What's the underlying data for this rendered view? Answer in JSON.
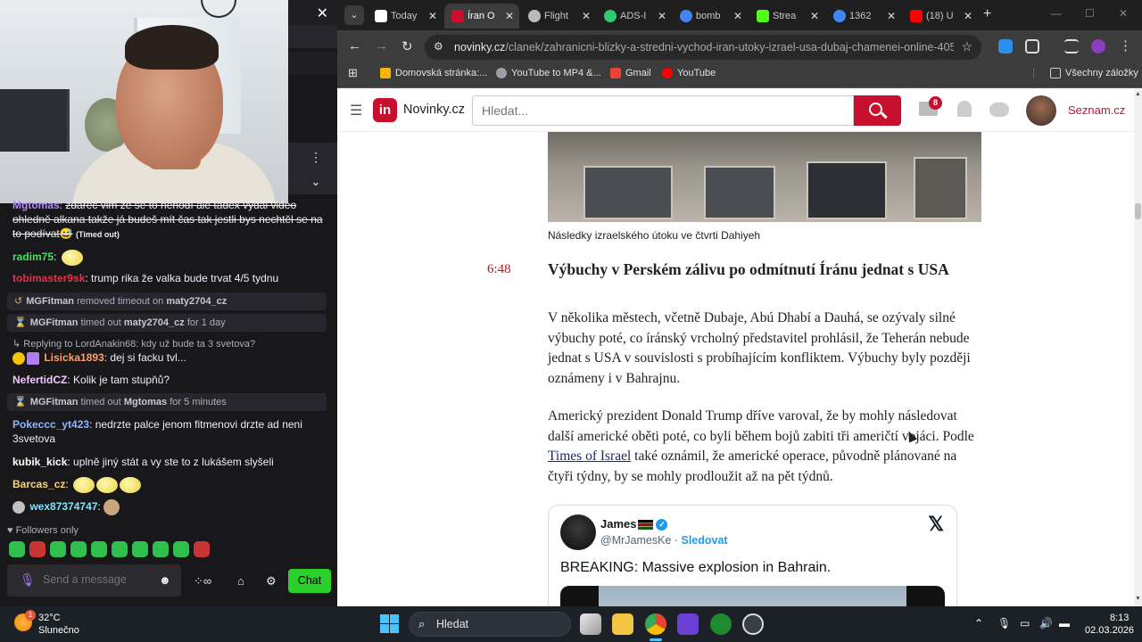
{
  "chat": {
    "close_glyph": "✕",
    "menu_glyph": "⋮",
    "collapse_glyph": "⌄",
    "messages": [
      {
        "user": "Mgtomas",
        "user_color": "#b488ff",
        "text": "zdarec vim že se to nehodí ale tadex vydal video ohledně alkana takže já budeš mít čas tak jestli bys nechtěl se na to podívat😅",
        "timed_out_label": "(Timed out)"
      },
      {
        "user": "radim75",
        "user_color": "#46e05a"
      },
      {
        "user": "tobimaster9sk",
        "user_color": "#e0314b",
        "text": "trump rika že valka bude trvat 4/5 tydnu"
      },
      {
        "user": "NefertidCZ",
        "user_color": "#f2c8ff",
        "text": "Kolik je tam stupňů?"
      },
      {
        "user": "Pokeccc_yt423",
        "user_color": "#8fb6ff",
        "text": "nedrzte palce jenom fitmenovi drzte ad neni 3svetova"
      },
      {
        "user": "kubik_kick",
        "user_color": "#ffffff",
        "text": "uplně jiný stát a vy ste to z lukášem slyšeli"
      },
      {
        "user": "Barcas_cz",
        "user_color": "#ffd36b"
      },
      {
        "user": "wex87374747",
        "user_color": "#7fe3ff"
      }
    ],
    "system": [
      {
        "actor": "MGFitman",
        "action": "removed timeout on",
        "target": "maty2704_cz",
        "suffix": ""
      },
      {
        "actor": "MGFitman",
        "action": "timed out",
        "target": "maty2704_cz",
        "suffix": "for 1 day"
      },
      {
        "actor": "MGFitman",
        "action": "timed out",
        "target": "Mgtomas",
        "suffix": "for 5 minutes"
      }
    ],
    "reply": {
      "context": "↳ Replying to LordAnakin68: kdy už bude ta 3 svetova?",
      "user": "Lisicka1893",
      "user_color": "#ff9e6b",
      "text": "dej si facku tvl..."
    },
    "followers_only": "♥ Followers only",
    "input_placeholder": "Send a message",
    "send_label": "Chat"
  },
  "browser": {
    "tabs": [
      {
        "label": "Today",
        "favicon_color": "#ffffff"
      },
      {
        "label": "Íran O",
        "favicon_color": "#c8102e"
      },
      {
        "label": "Flight",
        "favicon_color": "#bbbbbb"
      },
      {
        "label": "ADS-I",
        "favicon_color": "#2ecc71"
      },
      {
        "label": "bomb",
        "favicon_color": "#4285f4"
      },
      {
        "label": "Strea",
        "favicon_color": "#53fc18"
      },
      {
        "label": "1362",
        "favicon_color": "#4285f4"
      },
      {
        "label": "(18) U",
        "favicon_color": "#ff0000"
      }
    ],
    "url_host": "novinky.cz",
    "url_path": "/clanek/zahranicni-blizky-a-stredni-vychod-iran-utoky-izrael-usa-dubaj-chamenei-online-40564...",
    "bookmarks": [
      "Domovská stránka:...",
      "YouTube to MP4 &...",
      "Gmail",
      "YouTube"
    ],
    "all_bookmarks": "Všechny záložky"
  },
  "site": {
    "logo_mark": "in",
    "logo_name": "Novinky.cz",
    "search_placeholder": "Hledat...",
    "mail_count": "8",
    "seznam_link": "Seznam.cz",
    "brand_color": "#c8102e"
  },
  "article": {
    "photo_caption": "Následky izraelského útoku ve čtvrti Dahiyeh",
    "time": "6:48",
    "heading": "Výbuchy v Perském zálivu po odmítnutí Íránu jednat s USA",
    "para1": "V několika městech, včetně Dubaje, Abú Dhabí a Dauhá, se ozývaly silné výbuchy poté, co íránský vrcholný představitel prohlásil, že Teherán nebude jednat s USA v souvislosti s probíhajícím konfliktem. Výbuchy byly později oznámeny i v Bahrajnu.",
    "para2_a": "Americký prezident Donald Trump dříve varoval, že by mohly následovat další americké oběti poté, co byli během bojů zabiti tři američtí vojáci. Podle ",
    "para2_link": "Times of Israel",
    "para2_b": " také oznámil, že americké operace, původně plánované na čtyři týdny, by se mohly prodloužit až na pět týdnů."
  },
  "tweet": {
    "name": "James",
    "handle": "@MrJamesKe",
    "separator": " · ",
    "follow": "Sledovat",
    "text": "BREAKING: Massive explosion in Bahrain.",
    "verified_glyph": "✓",
    "logo_glyph": "𝕏"
  },
  "taskbar": {
    "temp": "32°C",
    "weather": "Slunečno",
    "weather_badge": "1",
    "search": "Hledat",
    "time": "8:13",
    "date": "02.03.2026"
  }
}
